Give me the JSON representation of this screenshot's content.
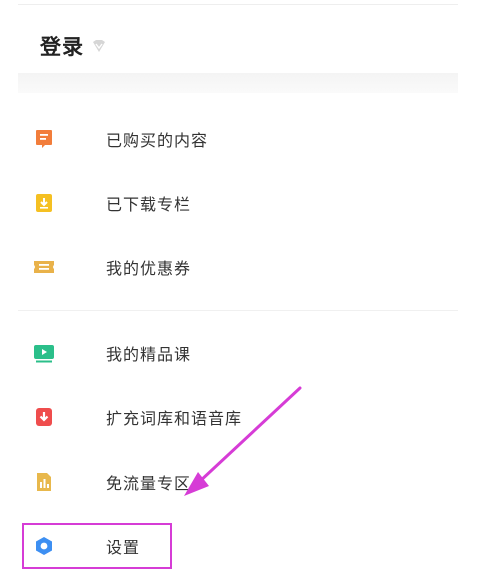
{
  "header": {
    "title": "登录"
  },
  "menu": {
    "items": [
      {
        "label": "已购买的内容",
        "icon": "receipt-icon",
        "color": "#f27d3b"
      },
      {
        "label": "已下载专栏",
        "icon": "download-icon",
        "color": "#f5c022"
      },
      {
        "label": "我的优惠券",
        "icon": "coupon-icon",
        "color": "#e9b24a"
      },
      {
        "label": "我的精品课",
        "icon": "video-icon",
        "color": "#2bbf8a"
      },
      {
        "label": "扩充词库和语音库",
        "icon": "download-icon",
        "color": "#ef4d4d"
      },
      {
        "label": "免流量专区",
        "icon": "data-bar-icon",
        "color": "#e8b84c"
      },
      {
        "label": "设置",
        "icon": "settings-hexagon-icon",
        "color": "#3d8ff2"
      }
    ]
  },
  "colors": {
    "highlight": "#d63cd6",
    "arrow": "#d63cd6"
  }
}
